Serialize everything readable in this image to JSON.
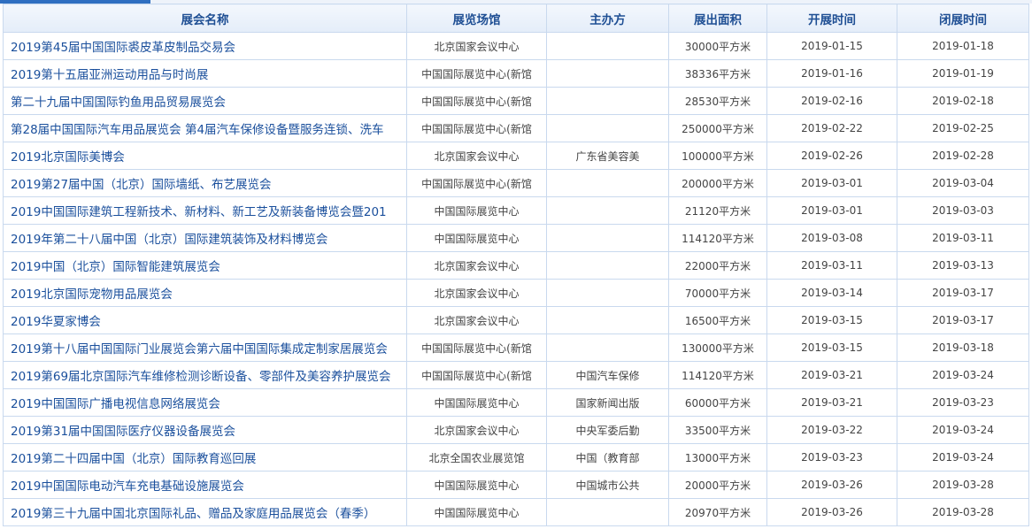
{
  "table": {
    "headers": [
      "展会名称",
      "展览场馆",
      "主办方",
      "展出面积",
      "开展时间",
      "闭展时间"
    ],
    "rows": [
      {
        "name": "2019第45届中国国际裘皮革皮制品交易会",
        "venue": "北京国家会议中心",
        "organizer": "",
        "area": "30000平方米",
        "start": "2019-01-15",
        "end": "2019-01-18"
      },
      {
        "name": "2019第十五届亚洲运动用品与时尚展",
        "venue": "中国国际展览中心(新馆",
        "organizer": "",
        "area": "38336平方米",
        "start": "2019-01-16",
        "end": "2019-01-19"
      },
      {
        "name": "第二十九届中国国际钓鱼用品贸易展览会",
        "venue": "中国国际展览中心(新馆",
        "organizer": "",
        "area": "28530平方米",
        "start": "2019-02-16",
        "end": "2019-02-18"
      },
      {
        "name": "第28届中国国际汽车用品展览会 第4届汽车保修设备暨服务连锁、洗车",
        "venue": "中国国际展览中心(新馆",
        "organizer": "",
        "area": "250000平方米",
        "start": "2019-02-22",
        "end": "2019-02-25"
      },
      {
        "name": "2019北京国际美博会",
        "venue": "北京国家会议中心",
        "organizer": "广东省美容美",
        "area": "100000平方米",
        "start": "2019-02-26",
        "end": "2019-02-28"
      },
      {
        "name": "2019第27届中国（北京）国际墙纸、布艺展览会",
        "venue": "中国国际展览中心(新馆",
        "organizer": "",
        "area": "200000平方米",
        "start": "2019-03-01",
        "end": "2019-03-04"
      },
      {
        "name": "2019中国国际建筑工程新技术、新材料、新工艺及新装备博览会暨201",
        "venue": "中国国际展览中心",
        "organizer": "",
        "area": "21120平方米",
        "start": "2019-03-01",
        "end": "2019-03-03"
      },
      {
        "name": "2019年第二十八届中国（北京）国际建筑装饰及材料博览会",
        "venue": "中国国际展览中心",
        "organizer": "",
        "area": "114120平方米",
        "start": "2019-03-08",
        "end": "2019-03-11"
      },
      {
        "name": "2019中国（北京）国际智能建筑展览会",
        "venue": "北京国家会议中心",
        "organizer": "",
        "area": "22000平方米",
        "start": "2019-03-11",
        "end": "2019-03-13"
      },
      {
        "name": "2019北京国际宠物用品展览会",
        "venue": "北京国家会议中心",
        "organizer": "",
        "area": "70000平方米",
        "start": "2019-03-14",
        "end": "2019-03-17"
      },
      {
        "name": "2019华夏家博会",
        "venue": "北京国家会议中心",
        "organizer": "",
        "area": "16500平方米",
        "start": "2019-03-15",
        "end": "2019-03-17"
      },
      {
        "name": "2019第十八届中国国际门业展览会第六届中国国际集成定制家居展览会",
        "venue": "中国国际展览中心(新馆",
        "organizer": "",
        "area": "130000平方米",
        "start": "2019-03-15",
        "end": "2019-03-18"
      },
      {
        "name": "2019第69届北京国际汽车维修检测诊断设备、零部件及美容养护展览会",
        "venue": "中国国际展览中心(新馆",
        "organizer": "中国汽车保修",
        "area": "114120平方米",
        "start": "2019-03-21",
        "end": "2019-03-24"
      },
      {
        "name": "2019中国国际广播电视信息网络展览会",
        "venue": "中国国际展览中心",
        "organizer": "国家新闻出版",
        "area": "60000平方米",
        "start": "2019-03-21",
        "end": "2019-03-23"
      },
      {
        "name": "2019第31届中国国际医疗仪器设备展览会",
        "venue": "北京国家会议中心",
        "organizer": "中央军委后勤",
        "area": "33500平方米",
        "start": "2019-03-22",
        "end": "2019-03-24"
      },
      {
        "name": "2019第二十四届中国（北京）国际教育巡回展",
        "venue": "北京全国农业展览馆",
        "organizer": "中国（教育部",
        "area": "13000平方米",
        "start": "2019-03-23",
        "end": "2019-03-24"
      },
      {
        "name": "2019中国国际电动汽车充电基础设施展览会",
        "venue": "中国国际展览中心",
        "organizer": "中国城市公共",
        "area": "20000平方米",
        "start": "2019-03-26",
        "end": "2019-03-28"
      },
      {
        "name": "2019第三十九届中国北京国际礼品、赠品及家庭用品展览会（春季）",
        "venue": "中国国际展览中心",
        "organizer": "",
        "area": "20970平方米",
        "start": "2019-03-26",
        "end": "2019-03-28"
      }
    ]
  }
}
